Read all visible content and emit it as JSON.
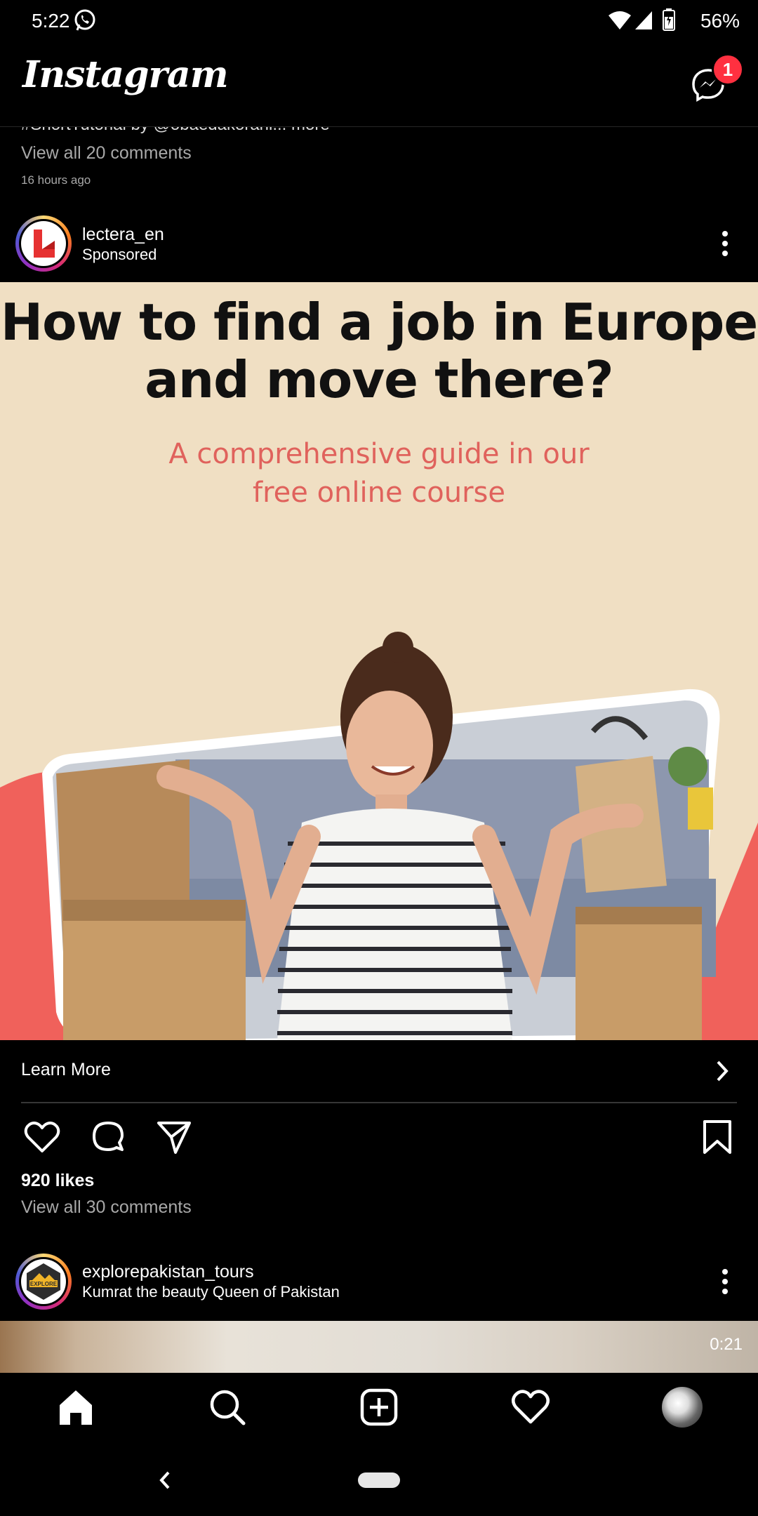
{
  "status_bar": {
    "time": "5:22",
    "battery": "56%"
  },
  "header": {
    "logo": "Instagram",
    "messages_badge": "1"
  },
  "previous_post": {
    "caption_fragment": "#ShortTutorial by @obaedakorani... more",
    "comments_link": "View all 20 comments",
    "timestamp": "16 hours ago"
  },
  "post": {
    "username": "lectera_en",
    "subtitle": "Sponsored",
    "ad_headline_line1": "How to find a job in Europe",
    "ad_headline_line2": "and move there?",
    "ad_subline_line1": "A comprehensive guide in our",
    "ad_subline_line2": "free online course",
    "cta_label": "Learn More",
    "likes": "920 likes",
    "comments_link": "View all 30 comments"
  },
  "next_post": {
    "username": "explorepakistan_tours",
    "subtitle": "Kumrat the beauty Queen of Pakistan",
    "video_duration": "0:21"
  },
  "bottom_nav": {
    "items": [
      "home-icon",
      "search-icon",
      "new-post-icon",
      "activity-icon",
      "profile-avatar"
    ]
  },
  "colors": {
    "accent_badge": "#ff3040",
    "ad_background": "#f0dfc3",
    "ad_subline": "#e0625c",
    "ad_shape": "#f0615b"
  }
}
